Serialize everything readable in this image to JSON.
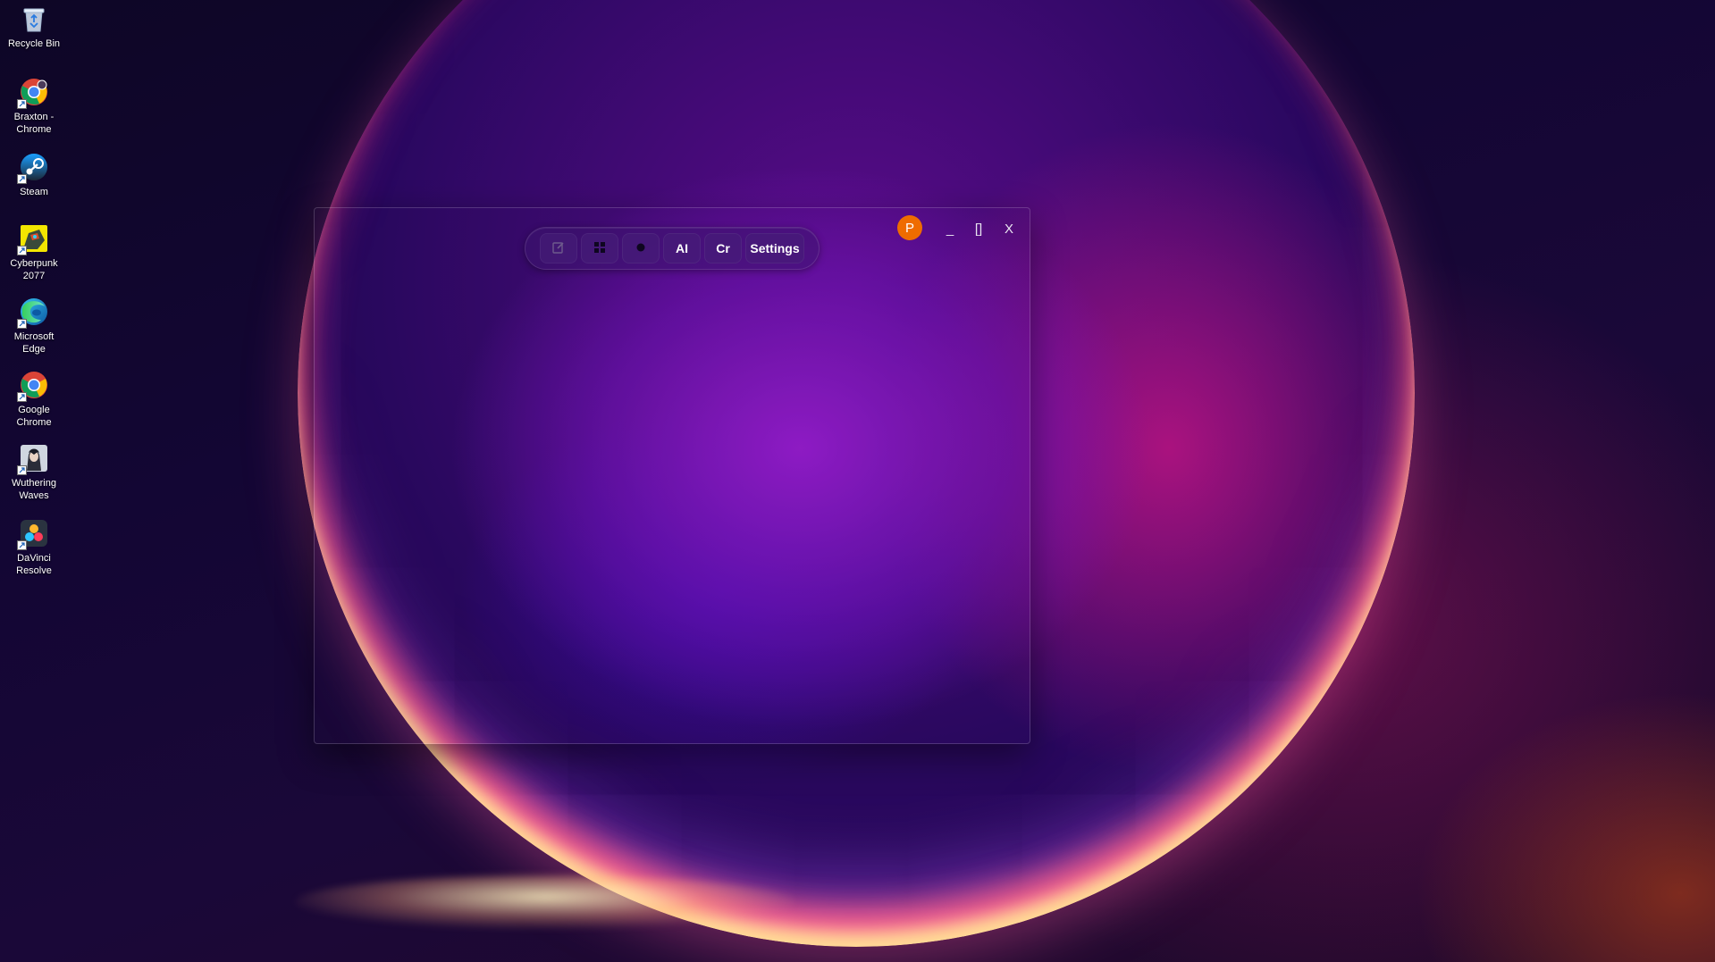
{
  "desktop_icons": [
    {
      "name": "recycle-bin-icon",
      "label": "Recycle Bin",
      "shortcut": false
    },
    {
      "name": "chrome-profile-icon",
      "label": "Braxton -\nChrome",
      "shortcut": true
    },
    {
      "name": "steam-icon",
      "label": "Steam",
      "shortcut": true
    },
    {
      "name": "cyberpunk-icon",
      "label": "Cyberpunk\n2077",
      "shortcut": true
    },
    {
      "name": "edge-icon",
      "label": "Microsoft\nEdge",
      "shortcut": true
    },
    {
      "name": "chrome-icon",
      "label": "Google\nChrome",
      "shortcut": true
    },
    {
      "name": "wuthering-waves-icon",
      "label": "Wuthering\nWaves",
      "shortcut": true
    },
    {
      "name": "davinci-resolve-icon",
      "label": "DaVinci\nResolve",
      "shortcut": true
    }
  ],
  "window": {
    "toolbar": {
      "buttons": [
        {
          "name": "edit-button",
          "icon": "edit-icon",
          "label": ""
        },
        {
          "name": "grid-button",
          "icon": "grid-icon",
          "label": ""
        },
        {
          "name": "record-button",
          "icon": "dot-icon",
          "label": ""
        },
        {
          "name": "ai-button",
          "label": "AI"
        },
        {
          "name": "cr-button",
          "label": "Cr"
        },
        {
          "name": "settings-button",
          "label": "Settings"
        }
      ]
    },
    "avatar_initial": "P",
    "avatar_color": "#ef6c00",
    "controls": {
      "minimize": "_",
      "maximize": "[]",
      "close": "X"
    }
  }
}
